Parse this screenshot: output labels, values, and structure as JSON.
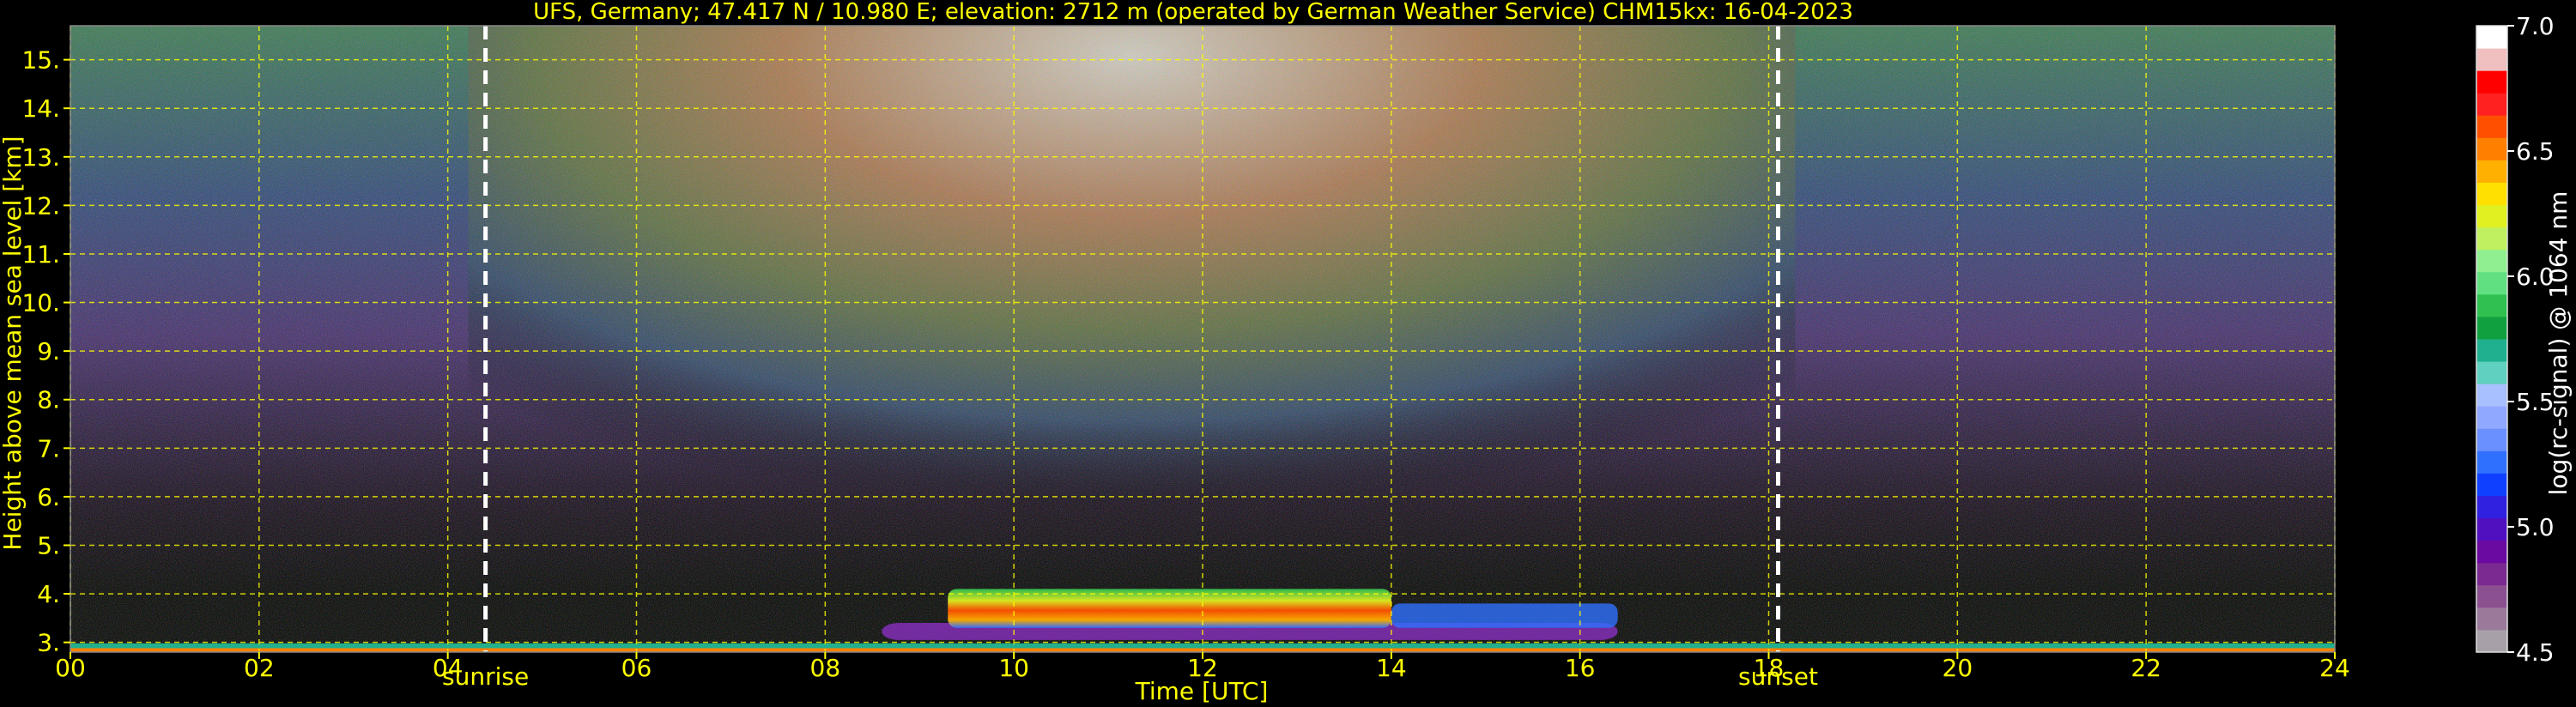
{
  "chart_data": {
    "type": "heatmap",
    "title": "UFS, Germany; 47.417 N / 10.980 E; elevation: 2712 m  (operated by German Weather Service)    CHM15kx: 16-04-2023",
    "xlabel": "Time [UTC]",
    "ylabel": "Height above mean sea level [km]",
    "xlim": [
      0,
      24
    ],
    "ylim": [
      2.8,
      15.7
    ],
    "x_ticks": [
      0,
      2,
      4,
      6,
      8,
      10,
      12,
      14,
      16,
      18,
      20,
      22,
      24
    ],
    "x_tick_labels": [
      "00",
      "02",
      "04",
      "06",
      "08",
      "10",
      "12",
      "14",
      "16",
      "18",
      "20",
      "22",
      "24"
    ],
    "y_ticks": [
      3,
      4,
      5,
      6,
      7,
      8,
      9,
      10,
      11,
      12,
      13,
      14,
      15
    ],
    "y_tick_labels": [
      "3.",
      "4.",
      "5.",
      "6.",
      "7.",
      "8.",
      "9.",
      "10.",
      "11.",
      "12.",
      "13.",
      "14.",
      "15."
    ],
    "grid": true,
    "grid_color": "#ffff00",
    "background_color": "#000000",
    "annotations": [
      {
        "label": "sunrise",
        "x": 4.4
      },
      {
        "label": "sunset",
        "x": 18.1
      }
    ],
    "colorbar": {
      "label": "log(rc-signal) @ 1064 nm",
      "range": [
        4.5,
        7.0
      ],
      "ticks": [
        4.5,
        5.0,
        5.5,
        6.0,
        6.5,
        7.0
      ],
      "tick_labels": [
        "4.5",
        "5.0",
        "5.5",
        "6.0",
        "6.5",
        "7.0"
      ],
      "colors": [
        "#a8a0a8",
        "#9a7a9a",
        "#8a5090",
        "#7a2a90",
        "#6a0aa0",
        "#5010c0",
        "#3020e0",
        "#1040ff",
        "#3070ff",
        "#6a90ff",
        "#90a8ff",
        "#a8c0ff",
        "#60d0c0",
        "#20b090",
        "#10a040",
        "#30c050",
        "#60e080",
        "#90f090",
        "#c0f060",
        "#e0f020",
        "#ffe000",
        "#ffb000",
        "#ff8000",
        "#ff5000",
        "#ff2020",
        "#ff0000",
        "#f0c0c0",
        "#ffffff"
      ]
    },
    "aerosol_layer": {
      "x_start": 9.3,
      "x_end": 14.0,
      "height_range": [
        3.3,
        4.1
      ],
      "peak_value": 6.7
    }
  },
  "colors": {
    "axes_text": "#ffff00",
    "colorbar_text": "#ffffff",
    "marker_line": "#ffffff"
  }
}
